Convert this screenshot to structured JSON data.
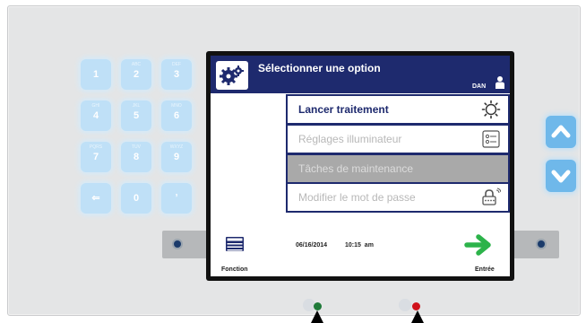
{
  "keypad": {
    "keys": [
      {
        "label": "1",
        "sub": "",
        "name": "key-1"
      },
      {
        "label": "2",
        "sub": "ABC",
        "name": "key-2"
      },
      {
        "label": "3",
        "sub": "DEF",
        "name": "key-3"
      },
      {
        "label": "4",
        "sub": "GHI",
        "name": "key-4"
      },
      {
        "label": "5",
        "sub": "JKL",
        "name": "key-5"
      },
      {
        "label": "6",
        "sub": "MNO",
        "name": "key-6"
      },
      {
        "label": "7",
        "sub": "PQRS",
        "name": "key-7"
      },
      {
        "label": "8",
        "sub": "TUV",
        "name": "key-8"
      },
      {
        "label": "9",
        "sub": "WXYZ",
        "name": "key-9"
      },
      {
        "label": "⇐",
        "sub": "",
        "name": "key-backspace"
      },
      {
        "label": "0",
        "sub": "",
        "name": "key-0"
      },
      {
        "label": "ʼ",
        "sub": "",
        "name": "key-tab"
      }
    ]
  },
  "screen": {
    "title": "Sélectionner une option",
    "user": "DAN",
    "menu": [
      {
        "label": "Lancer traitement",
        "state": "active",
        "icon": "sun-icon"
      },
      {
        "label": "Réglages illuminateur",
        "state": "disabled",
        "icon": "settings-sliders-icon"
      },
      {
        "label": "Tâches de maintenance",
        "state": "highlighted",
        "icon": ""
      },
      {
        "label": "Modifier le mot de passe",
        "state": "disabled",
        "icon": "lock-icon"
      }
    ],
    "date": "06/16/2014",
    "time": "10:15 am",
    "fonction_label": "Fonction",
    "entree_label": "Entrée"
  },
  "colors": {
    "titlebar": "#1e2a6e",
    "enter_arrow": "#2cb34a",
    "led_left": "#1f7a3a",
    "led_right": "#d0121b"
  }
}
